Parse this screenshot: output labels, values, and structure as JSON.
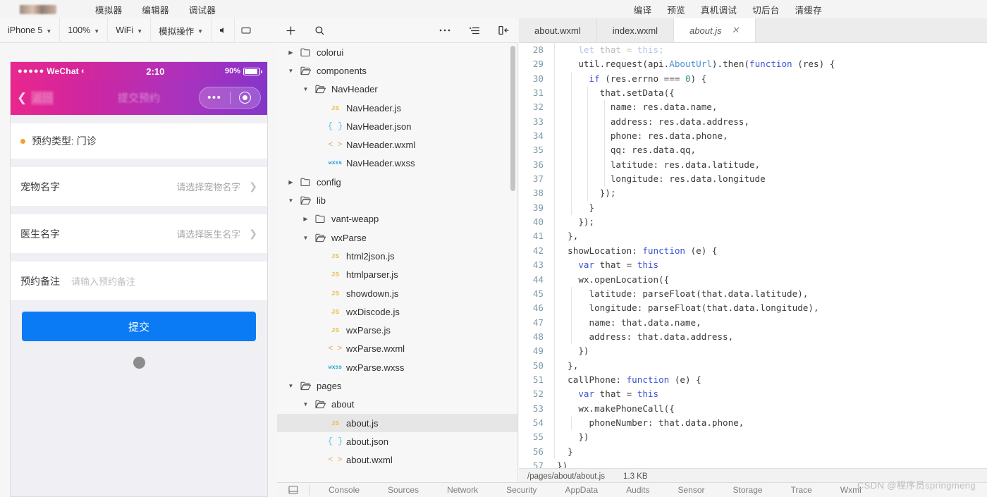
{
  "topbar": {
    "left_menu": [
      "模拟器",
      "编辑器",
      "调试器"
    ],
    "right_menu": [
      "编译",
      "预览",
      "真机调试",
      "切后台",
      "清缓存"
    ]
  },
  "simulator_toolbar": {
    "device": "iPhone 5",
    "zoom": "100%",
    "network": "WiFi",
    "action": "模拟操作",
    "volume_icon": "speaker-icon",
    "rotate_icon": "rotate-screen-icon"
  },
  "phone": {
    "status_bar": {
      "carrier_dots": "●●●●●",
      "carrier": "WeChat",
      "wifi_icon": "wifi-icon",
      "time": "2:10",
      "battery_percent": "90%"
    },
    "nav": {
      "back_label": "返回",
      "title": "提交预约",
      "capsule_more": "•••",
      "capsule_target": "target-icon"
    },
    "form": {
      "type_row": "预约类型: 门诊",
      "rows": [
        {
          "label": "宠物名字",
          "value": "请选择宠物名字"
        },
        {
          "label": "医生名字",
          "value": "请选择医生名字"
        }
      ],
      "note_label": "预约备注",
      "note_placeholder": "请输入预约备注",
      "submit_label": "提交",
      "accent_color": "#0b7bf5"
    }
  },
  "tree_toolbar": {
    "add_icon": "plus-icon",
    "search_icon": "search-icon",
    "more_icon": "ellipsis-icon",
    "sort_icon": "sort-list-icon",
    "collapse_icon": "collapse-panel-icon"
  },
  "file_tree": [
    {
      "name": "colorui",
      "indent": 0,
      "kind": "folder",
      "twisty": "collapsed",
      "selected": false
    },
    {
      "name": "components",
      "indent": 0,
      "kind": "folder",
      "twisty": "expanded",
      "selected": false
    },
    {
      "name": "NavHeader",
      "indent": 1,
      "kind": "folder",
      "twisty": "expanded",
      "selected": false
    },
    {
      "name": "NavHeader.js",
      "indent": 2,
      "kind": "js",
      "twisty": "none",
      "selected": false
    },
    {
      "name": "NavHeader.json",
      "indent": 2,
      "kind": "json",
      "twisty": "none",
      "selected": false
    },
    {
      "name": "NavHeader.wxml",
      "indent": 2,
      "kind": "wxml",
      "twisty": "none",
      "selected": false
    },
    {
      "name": "NavHeader.wxss",
      "indent": 2,
      "kind": "wxss",
      "twisty": "none",
      "selected": false
    },
    {
      "name": "config",
      "indent": 0,
      "kind": "folder",
      "twisty": "collapsed",
      "selected": false
    },
    {
      "name": "lib",
      "indent": 0,
      "kind": "folder",
      "twisty": "expanded",
      "selected": false
    },
    {
      "name": "vant-weapp",
      "indent": 1,
      "kind": "folder",
      "twisty": "collapsed",
      "selected": false
    },
    {
      "name": "wxParse",
      "indent": 1,
      "kind": "folder",
      "twisty": "expanded",
      "selected": false
    },
    {
      "name": "html2json.js",
      "indent": 2,
      "kind": "js",
      "twisty": "none",
      "selected": false
    },
    {
      "name": "htmlparser.js",
      "indent": 2,
      "kind": "js",
      "twisty": "none",
      "selected": false
    },
    {
      "name": "showdown.js",
      "indent": 2,
      "kind": "js",
      "twisty": "none",
      "selected": false
    },
    {
      "name": "wxDiscode.js",
      "indent": 2,
      "kind": "js",
      "twisty": "none",
      "selected": false
    },
    {
      "name": "wxParse.js",
      "indent": 2,
      "kind": "js",
      "twisty": "none",
      "selected": false
    },
    {
      "name": "wxParse.wxml",
      "indent": 2,
      "kind": "wxml",
      "twisty": "none",
      "selected": false
    },
    {
      "name": "wxParse.wxss",
      "indent": 2,
      "kind": "wxss",
      "twisty": "none",
      "selected": false
    },
    {
      "name": "pages",
      "indent": 0,
      "kind": "folder",
      "twisty": "expanded",
      "selected": false
    },
    {
      "name": "about",
      "indent": 1,
      "kind": "folder",
      "twisty": "expanded",
      "selected": false
    },
    {
      "name": "about.js",
      "indent": 2,
      "kind": "js",
      "twisty": "none",
      "selected": true
    },
    {
      "name": "about.json",
      "indent": 2,
      "kind": "json",
      "twisty": "none",
      "selected": false
    },
    {
      "name": "about.wxml",
      "indent": 2,
      "kind": "wxml",
      "twisty": "none",
      "selected": false
    }
  ],
  "editor": {
    "tabs": [
      {
        "label": "about.wxml",
        "active": false,
        "closable": false
      },
      {
        "label": "index.wxml",
        "active": false,
        "closable": false
      },
      {
        "label": "about.js",
        "active": true,
        "closable": true
      }
    ],
    "close_glyph": "✕",
    "first_line_number": 28,
    "lines": [
      {
        "n": 28,
        "text": "    let that = this;",
        "guides": 1,
        "faded": true
      },
      {
        "n": 29,
        "text": "    util.request(api.AboutUrl).then(function (res) {",
        "guides": 1
      },
      {
        "n": 30,
        "text": "      if (res.errno === 0) {",
        "guides": 2
      },
      {
        "n": 31,
        "text": "        that.setData({",
        "guides": 3
      },
      {
        "n": 32,
        "text": "          name: res.data.name,",
        "guides": 4
      },
      {
        "n": 33,
        "text": "          address: res.data.address,",
        "guides": 4
      },
      {
        "n": 34,
        "text": "          phone: res.data.phone,",
        "guides": 4
      },
      {
        "n": 35,
        "text": "          qq: res.data.qq,",
        "guides": 4
      },
      {
        "n": 36,
        "text": "          latitude: res.data.latitude,",
        "guides": 4
      },
      {
        "n": 37,
        "text": "          longitude: res.data.longitude",
        "guides": 4
      },
      {
        "n": 38,
        "text": "        });",
        "guides": 3
      },
      {
        "n": 39,
        "text": "      }",
        "guides": 2
      },
      {
        "n": 40,
        "text": "    });",
        "guides": 1
      },
      {
        "n": 41,
        "text": "  },",
        "guides": 1
      },
      {
        "n": 42,
        "text": "  showLocation: function (e) {",
        "guides": 1
      },
      {
        "n": 43,
        "text": "    var that = this",
        "guides": 1
      },
      {
        "n": 44,
        "text": "    wx.openLocation({",
        "guides": 1
      },
      {
        "n": 45,
        "text": "      latitude: parseFloat(that.data.latitude),",
        "guides": 2
      },
      {
        "n": 46,
        "text": "      longitude: parseFloat(that.data.longitude),",
        "guides": 2
      },
      {
        "n": 47,
        "text": "      name: that.data.name,",
        "guides": 2
      },
      {
        "n": 48,
        "text": "      address: that.data.address,",
        "guides": 2
      },
      {
        "n": 49,
        "text": "    })",
        "guides": 1
      },
      {
        "n": 50,
        "text": "  },",
        "guides": 1
      },
      {
        "n": 51,
        "text": "  callPhone: function (e) {",
        "guides": 1
      },
      {
        "n": 52,
        "text": "    var that = this",
        "guides": 1
      },
      {
        "n": 53,
        "text": "    wx.makePhoneCall({",
        "guides": 1
      },
      {
        "n": 54,
        "text": "      phoneNumber: that.data.phone,",
        "guides": 2
      },
      {
        "n": 55,
        "text": "    })",
        "guides": 1
      },
      {
        "n": 56,
        "text": "  }",
        "guides": 1
      },
      {
        "n": 57,
        "text": "})",
        "guides": 0
      }
    ]
  },
  "status_bar": {
    "path": "/pages/about/about.js",
    "size": "1.3 KB"
  },
  "devtools": {
    "dock_icon": "dock-panel-icon",
    "tabs": [
      "Console",
      "Sources",
      "Network",
      "Security",
      "AppData",
      "Audits",
      "Sensor",
      "Storage",
      "Trace",
      "Wxml"
    ]
  },
  "watermark": "CSDN @程序员springmeng"
}
